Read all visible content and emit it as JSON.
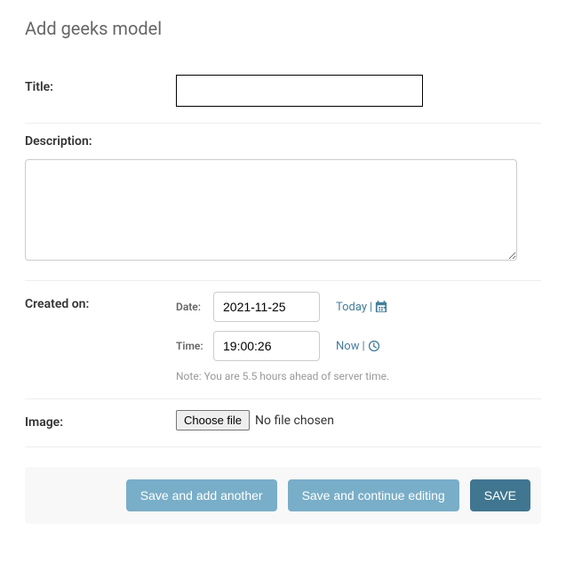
{
  "page": {
    "title": "Add geeks model"
  },
  "fields": {
    "title": {
      "label": "Title:",
      "value": ""
    },
    "description": {
      "label": "Description:",
      "value": ""
    },
    "created_on": {
      "label": "Created on:",
      "date": {
        "sub_label": "Date:",
        "value": "2021-11-25",
        "today_link": "Today"
      },
      "time": {
        "sub_label": "Time:",
        "value": "19:00:26",
        "now_link": "Now"
      },
      "note": "Note: You are 5.5 hours ahead of server time."
    },
    "image": {
      "label": "Image:",
      "button": "Choose file",
      "status": "No file chosen"
    }
  },
  "actions": {
    "save_add_another": "Save and add another",
    "save_continue": "Save and continue editing",
    "save": "SAVE"
  }
}
